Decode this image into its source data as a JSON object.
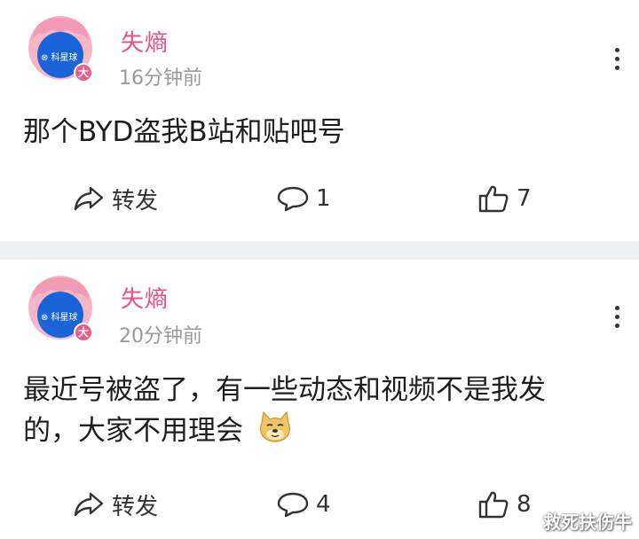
{
  "posts": [
    {
      "username": "失熵",
      "time": "16分钟前",
      "text": "那个BYD盗我B站和贴吧号",
      "avatar_badge": "大",
      "avatar_label": "⊗ 科星球",
      "share_label": "转发",
      "comments": "1",
      "likes": "7"
    },
    {
      "username": "失熵",
      "time": "20分钟前",
      "text_line1": "最近号被盗了，有一些动态和视频不是我发",
      "text_line2": "的，大家不用理会",
      "emoji": "doge-emoji",
      "avatar_badge": "大",
      "avatar_label": "⊗ 科星球",
      "share_label": "转发",
      "comments": "4",
      "likes": "8"
    }
  ],
  "watermark": "救死扶伤牛",
  "colors": {
    "username": "#e8508b",
    "avatar_hair": "#f6b6c8",
    "avatar_face": "#1a63d8",
    "badge": "#ee5a86",
    "page_bg": "#eef0f3"
  }
}
